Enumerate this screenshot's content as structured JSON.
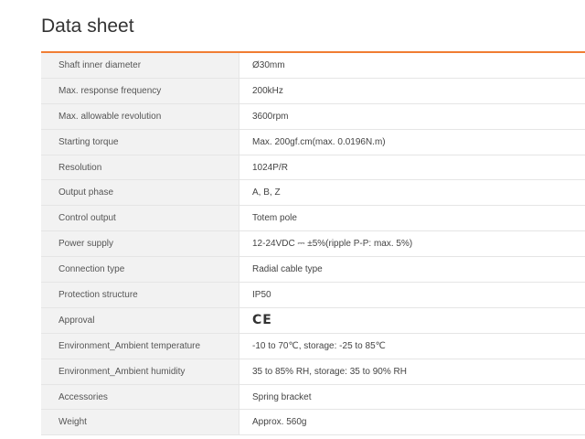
{
  "page": {
    "title": "Data sheet"
  },
  "accent_color": "#f07d33",
  "specs": [
    {
      "label": "Shaft inner diameter",
      "value": "Ø30mm"
    },
    {
      "label": "Max. response frequency",
      "value": "200kHz"
    },
    {
      "label": "Max. allowable revolution",
      "value": "3600rpm"
    },
    {
      "label": "Starting torque",
      "value": "Max. 200gf.cm(max. 0.0196N.m)"
    },
    {
      "label": "Resolution",
      "value": "1024P/R"
    },
    {
      "label": "Output phase",
      "value": "A, B, Z"
    },
    {
      "label": "Control output",
      "value": "Totem pole"
    },
    {
      "label": "Power supply",
      "value": "12-24VDC ⎓ ±5%(ripple P-P: max. 5%)"
    },
    {
      "label": "Connection type",
      "value": "Radial cable type"
    },
    {
      "label": "Protection structure",
      "value": "IP50"
    },
    {
      "label": "Approval",
      "value": "CE",
      "icon": "ce-mark-icon"
    },
    {
      "label": "Environment_Ambient temperature",
      "value": "-10 to 70℃, storage: -25 to 85℃"
    },
    {
      "label": "Environment_Ambient humidity",
      "value": "35 to 85% RH, storage: 35 to 90% RH"
    },
    {
      "label": "Accessories",
      "value": "Spring bracket"
    },
    {
      "label": "Weight",
      "value": "Approx. 560g"
    }
  ]
}
